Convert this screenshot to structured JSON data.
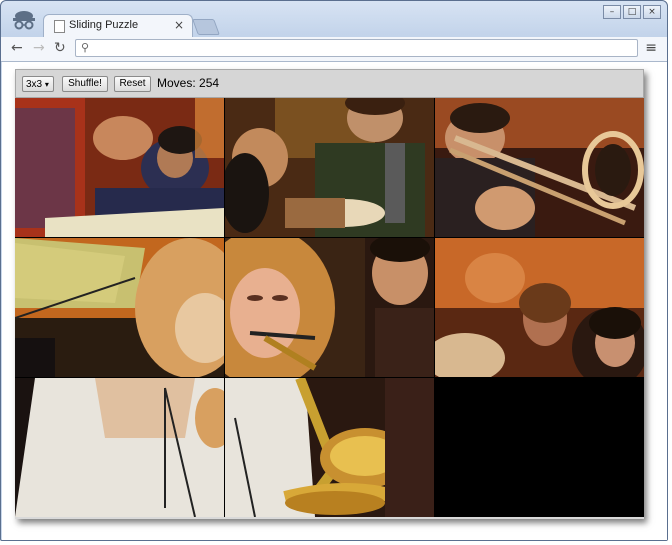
{
  "browser": {
    "tab_title": "Sliding Puzzle",
    "address_value": "",
    "close_glyph": "×",
    "menu_glyph": "≡"
  },
  "game": {
    "size_selected": "3x3",
    "size_arrow": "▾",
    "shuffle_label": "Shuffle!",
    "reset_label": "Reset",
    "moves_label": "Moves: ",
    "moves_value": "254",
    "tiles": [
      {
        "scene": "crowd-left"
      },
      {
        "scene": "guitarist"
      },
      {
        "scene": "trombone"
      },
      {
        "scene": "music-stand"
      },
      {
        "scene": "sax-face"
      },
      {
        "scene": "audience-right"
      },
      {
        "scene": "saxophonist-body"
      },
      {
        "scene": "sax-bell"
      },
      {
        "scene": "empty"
      }
    ]
  }
}
